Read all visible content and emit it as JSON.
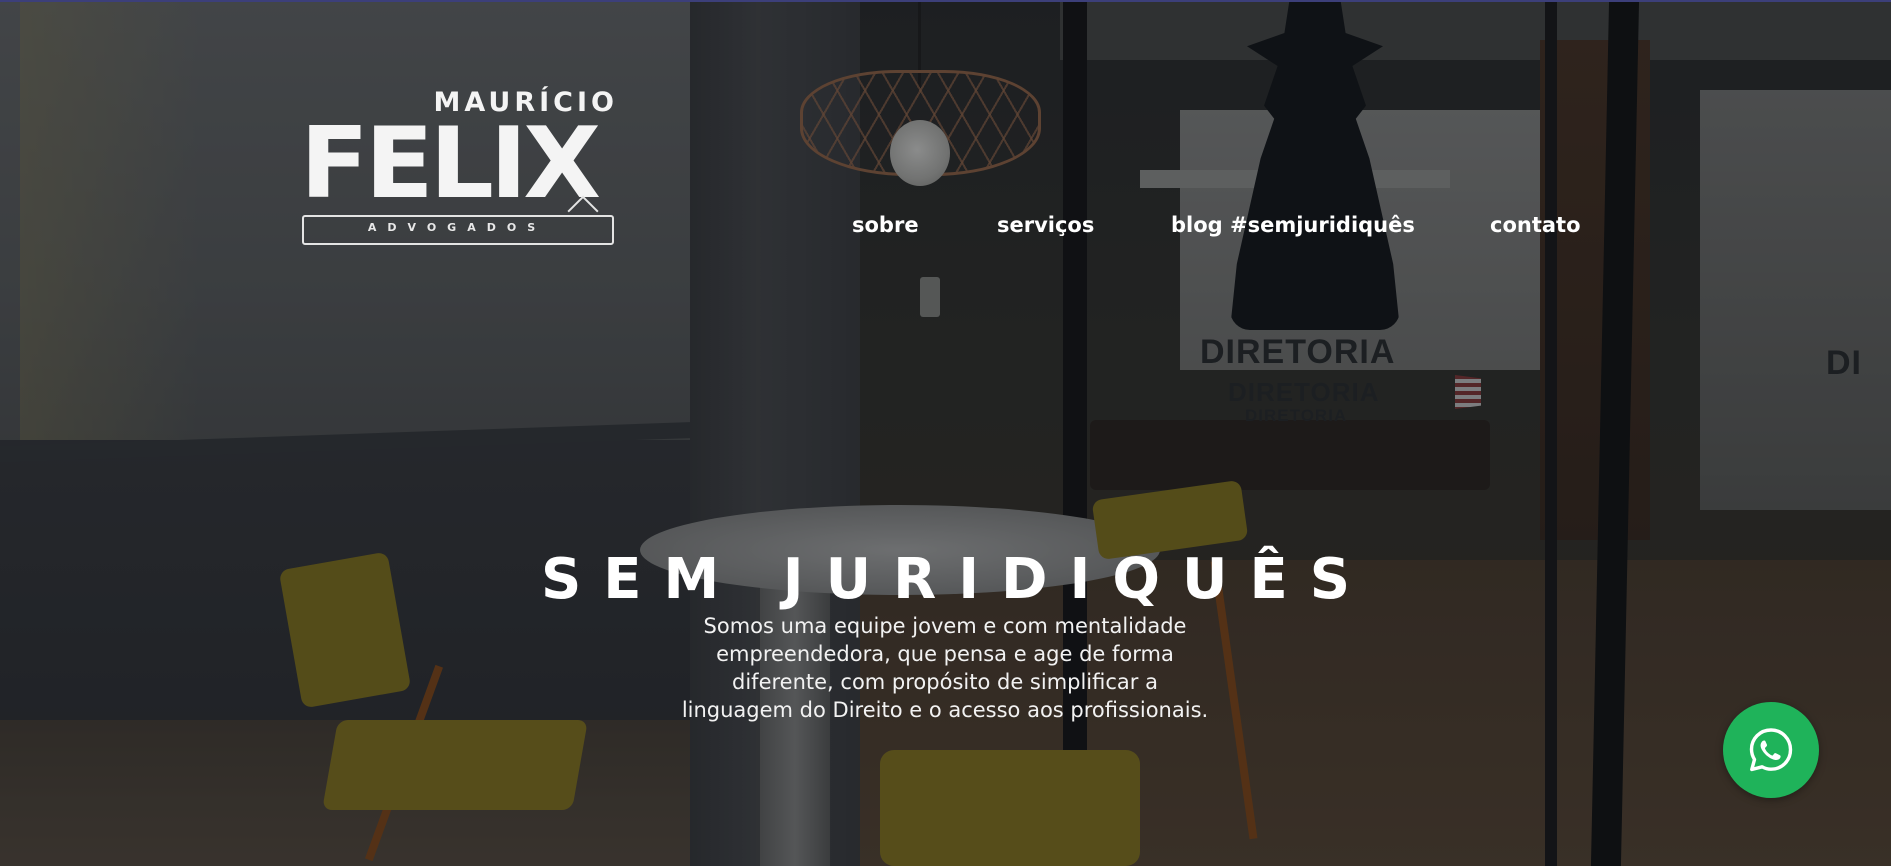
{
  "brand": {
    "first_name": "MAURÍCIO",
    "last_name": "FELIX",
    "tagline": "ADVOGADOS"
  },
  "nav": {
    "items": [
      {
        "label": "sobre"
      },
      {
        "label": "serviços"
      },
      {
        "label": "blog #semjuridiquês"
      },
      {
        "label": "contato"
      }
    ]
  },
  "hero": {
    "headline": "SEM JURIDIQUÊS",
    "description_lines": [
      "Somos uma equipe jovem e com mentalidade",
      "empreendedora, que pensa e age de forma",
      "diferente, com propósito de simplificar a",
      "linguagem do Direito e o acesso aos profissionais."
    ],
    "background_signage": [
      "DIRETORIA",
      "DIRETORIA",
      "DIRETORIA",
      "DI"
    ]
  },
  "whatsapp": {
    "icon": "whatsapp-icon",
    "color": "#1fb35a"
  },
  "colors": {
    "text": "#ffffff",
    "overlay": "#0a0c10",
    "accent_green": "#1fb35a"
  }
}
